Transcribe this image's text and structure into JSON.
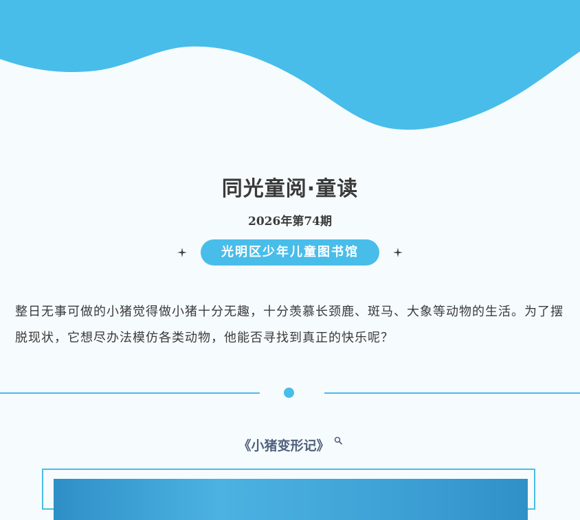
{
  "header": {
    "wave_color": "#48bde9"
  },
  "title": "同光童阅·童读",
  "issue": "2026年第74期",
  "organizer": "光明区少年儿童图书馆",
  "intro": "整日无事可做的小猪觉得做小猪十分无趣，十分羡慕长颈鹿、斑马、大象等动物的生活。为了摆脱现状，它想尽办法模仿各类动物，他能否寻找到真正的快乐呢？",
  "book": {
    "title": "《小猪变形记》",
    "icon": "search-icon"
  },
  "colors": {
    "accent": "#48bde9",
    "background": "#f6fbfd",
    "text": "#3a3a3a",
    "book_title": "#50617d"
  }
}
